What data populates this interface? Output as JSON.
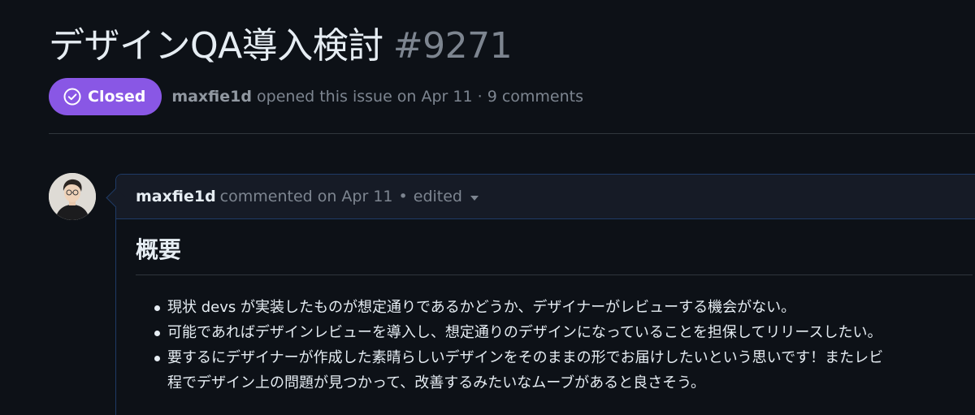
{
  "issue": {
    "title": "デザインQA導入検討",
    "number": "#9271",
    "state_label": "Closed",
    "author": "maxfie1d",
    "opened_text": "opened this issue on Apr 11 · 9 comments"
  },
  "comment": {
    "author": "maxfie1d",
    "when": "commented on Apr 11",
    "separator": "•",
    "edited_label": "edited",
    "heading": "概要",
    "items": [
      {
        "line1": "現状 devs が実装したものが想定通りであるかどうか、デザイナーがレビューする機会がない。",
        "line2": ""
      },
      {
        "line1": "可能であればデザインレビューを導入し、想定通りのデザインになっていることを担保してリリースしたい。",
        "line2": ""
      },
      {
        "line1": "要するにデザイナーが作成した素晴らしいデザインをそのままの形でお届けしたいという思いです！またレビ",
        "line2": "程でデザイン上の問題が見つかって、改善するみたいなムーブがあると良さそう。"
      }
    ]
  },
  "colors": {
    "background": "#0d1117",
    "closed_badge": "#8957e5",
    "comment_border": "#1f3b66",
    "muted_text": "#7d8590"
  },
  "icons": {
    "state": "check-circle-icon",
    "edited": "caret-down-icon"
  }
}
